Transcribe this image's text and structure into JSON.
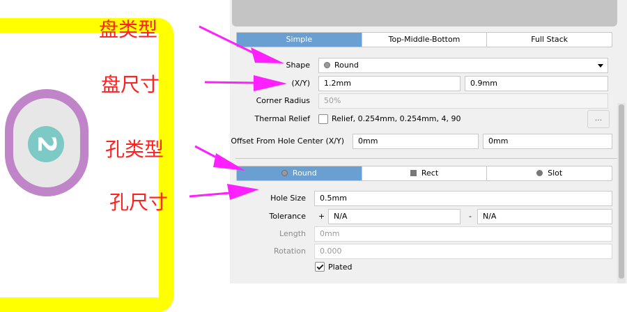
{
  "annotations": {
    "pad_shape": "盘类型",
    "pad_size": "盘尺寸",
    "hole_shape": "孔类型",
    "hole_size": "孔尺寸"
  },
  "illustration": {
    "pad_number": "2",
    "colors": {
      "outline": "#ffff00",
      "pad": "#c084c8",
      "hole": "#7cc9c5",
      "arrow": "#ff20ff",
      "annotation": "#ff2020"
    }
  },
  "pad": {
    "tabs": [
      {
        "label": "Simple",
        "active": true
      },
      {
        "label": "Top-Middle-Bottom",
        "active": false
      },
      {
        "label": "Full Stack",
        "active": false
      }
    ],
    "shape_label": "Shape",
    "shape_value": "Round",
    "xy_label": "(X/Y)",
    "x_value": "1.2mm",
    "y_value": "0.9mm",
    "corner_radius_label": "Corner Radius",
    "corner_radius_value": "50%",
    "thermal_relief_label": "Thermal Relief",
    "thermal_relief_value": "Relief, 0.254mm, 0.254mm, 4, 90",
    "thermal_button": "...",
    "offset_label": "Offset From Hole Center (X/Y)",
    "offset_x": "0mm",
    "offset_y": "0mm"
  },
  "hole": {
    "tabs": [
      {
        "label": "Round",
        "active": true,
        "icon": "circle-icon"
      },
      {
        "label": "Rect",
        "active": false,
        "icon": "square-icon"
      },
      {
        "label": "Slot",
        "active": false,
        "icon": "slot-icon"
      }
    ],
    "size_label": "Hole Size",
    "size_value": "0.5mm",
    "tolerance_label": "Tolerance",
    "tol_plus_sign": "+",
    "tol_plus_value": "N/A",
    "tol_minus_sign": "-",
    "tol_minus_value": "N/A",
    "length_label": "Length",
    "length_value": "0mm",
    "rotation_label": "Rotation",
    "rotation_value": "0.000",
    "plated_label": "Plated",
    "plated": true
  }
}
